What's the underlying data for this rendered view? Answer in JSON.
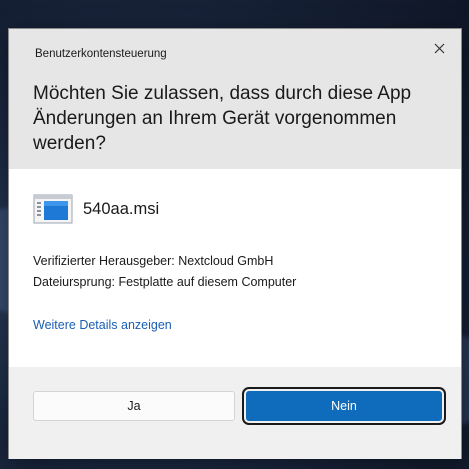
{
  "dialog": {
    "title": "Benutzerkontensteuerung",
    "close_icon": "close-icon",
    "question": "Möchten Sie zulassen, dass durch diese App Änderungen an Ihrem Gerät vorgenommen werden?",
    "file": {
      "icon": "installer-package-icon",
      "name": "540aa.msi"
    },
    "publisher_line": "Verifizierter Herausgeber: Nextcloud GmbH",
    "origin_line": "Dateiursprung: Festplatte auf diesem Computer",
    "details_link": "Weitere Details anzeigen",
    "buttons": {
      "yes_label": "Ja",
      "no_label": "Nein"
    }
  },
  "colors": {
    "header_bg": "#e6e6e6",
    "footer_bg": "#f0f0f0",
    "primary_button": "#0f6cbd",
    "link": "#1a5fb4"
  }
}
